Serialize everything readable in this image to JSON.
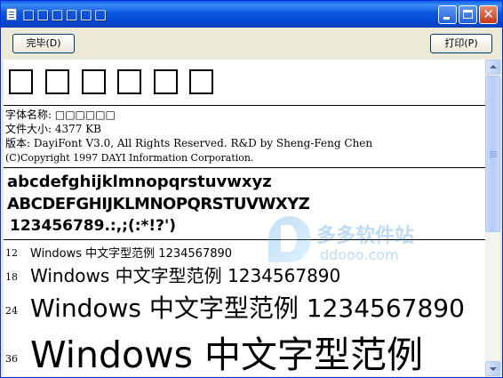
{
  "window": {
    "title": "□□□□□□",
    "icon": "document-icon"
  },
  "titlebar_buttons": {
    "close_glyph": "✕"
  },
  "toolbar": {
    "done_label": "完毕(D)",
    "print_label": "打印(P)"
  },
  "font_info": {
    "glyphs": [
      "□",
      "□",
      "□",
      "□",
      "□",
      "□"
    ],
    "name_line": "字体名称: □□□□□□",
    "size_line": "文件大小: 4377 KB",
    "version_line": "版本: DayiFont V3.0, All Rights Reserved. R&D by Sheng-Feng Chen",
    "copyright_line": "(C)Copyright 1997 DAYI Information Corporation."
  },
  "character_set": {
    "lowercase": "abcdefghijklmnopqrstuvwxyz",
    "uppercase": "ABCDEFGHIJKLMNOPQRSTUVWXYZ",
    "digits": "123456789.:,;(:*!?')"
  },
  "size_samples": [
    {
      "size": "12",
      "text": "Windows 中文字型范例  1234567890"
    },
    {
      "size": "18",
      "text": "Windows 中文字型范例  1234567890"
    },
    {
      "size": "24",
      "text": "Windows 中文字型范例  1234567890"
    },
    {
      "size": "36",
      "text": "Windows 中文字型范例"
    }
  ],
  "watermark": {
    "title": "多多软件站",
    "url": "ddooo.com"
  },
  "scrollbar": {
    "position": 0
  }
}
